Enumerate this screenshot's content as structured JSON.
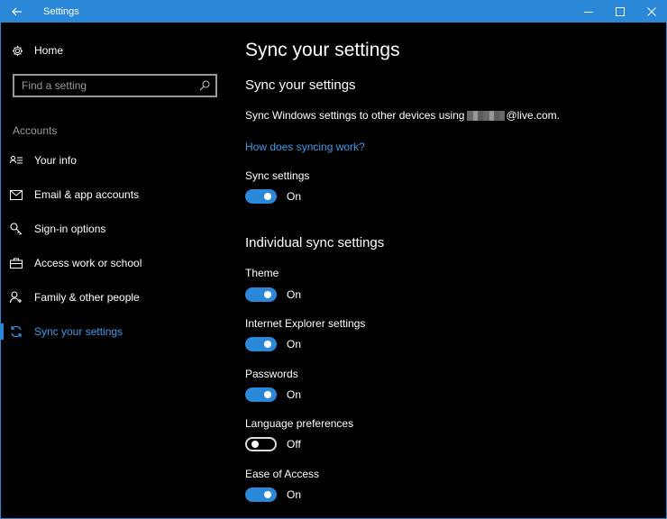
{
  "window": {
    "title": "Settings",
    "colors": {
      "accent": "#2b88d8",
      "link": "#3c9be8",
      "background": "#000000"
    }
  },
  "sidebar": {
    "home_label": "Home",
    "search_placeholder": "Find a setting",
    "section_label": "Accounts",
    "items": [
      {
        "label": "Your info",
        "icon": "contact-card-icon"
      },
      {
        "label": "Email & app accounts",
        "icon": "mail-icon"
      },
      {
        "label": "Sign-in options",
        "icon": "key-icon"
      },
      {
        "label": "Access work or school",
        "icon": "briefcase-icon"
      },
      {
        "label": "Family & other people",
        "icon": "person-add-icon"
      },
      {
        "label": "Sync your settings",
        "icon": "sync-icon",
        "active": true
      }
    ]
  },
  "main": {
    "page_title": "Sync your settings",
    "section1_title": "Sync your settings",
    "description_prefix": "Sync Windows settings to other devices using",
    "description_suffix": "@live.com.",
    "link_text": "How does syncing work?",
    "sync_settings": {
      "label": "Sync settings",
      "state": "On",
      "on": true
    },
    "section2_title": "Individual sync settings",
    "individual": [
      {
        "label": "Theme",
        "state": "On",
        "on": true
      },
      {
        "label": "Internet Explorer settings",
        "state": "On",
        "on": true
      },
      {
        "label": "Passwords",
        "state": "On",
        "on": true
      },
      {
        "label": "Language preferences",
        "state": "Off",
        "on": false
      },
      {
        "label": "Ease of Access",
        "state": "On",
        "on": true
      }
    ]
  }
}
